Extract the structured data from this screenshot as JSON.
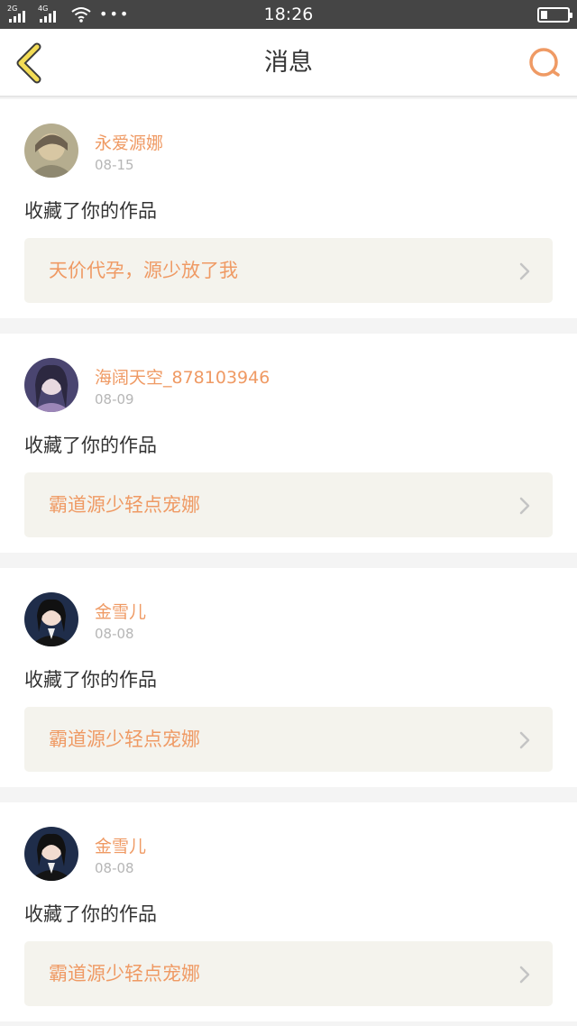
{
  "status_bar": {
    "network_1": "2G",
    "network_2": "4G",
    "time": "18:26",
    "battery_level": 0.25,
    "icons": [
      "signal-icon",
      "wifi-icon",
      "more-dots-icon",
      "battery-icon"
    ]
  },
  "nav": {
    "title": "消息",
    "back_icon": "chevron-left-icon",
    "search_icon": "search-icon",
    "accent": "#ef9a64"
  },
  "messages": [
    {
      "user": "永爱源娜",
      "date": "08-15",
      "action": "收藏了你的作品",
      "work": "天价代孕，源少放了我"
    },
    {
      "user": "海阔天空_878103946",
      "date": "08-09",
      "action": "收藏了你的作品",
      "work": "霸道源少轻点宠娜"
    },
    {
      "user": "金雪儿",
      "date": "08-08",
      "action": "收藏了你的作品",
      "work": "霸道源少轻点宠娜"
    },
    {
      "user": "金雪儿",
      "date": "08-08",
      "action": "收藏了你的作品",
      "work": "霸道源少轻点宠娜"
    }
  ]
}
